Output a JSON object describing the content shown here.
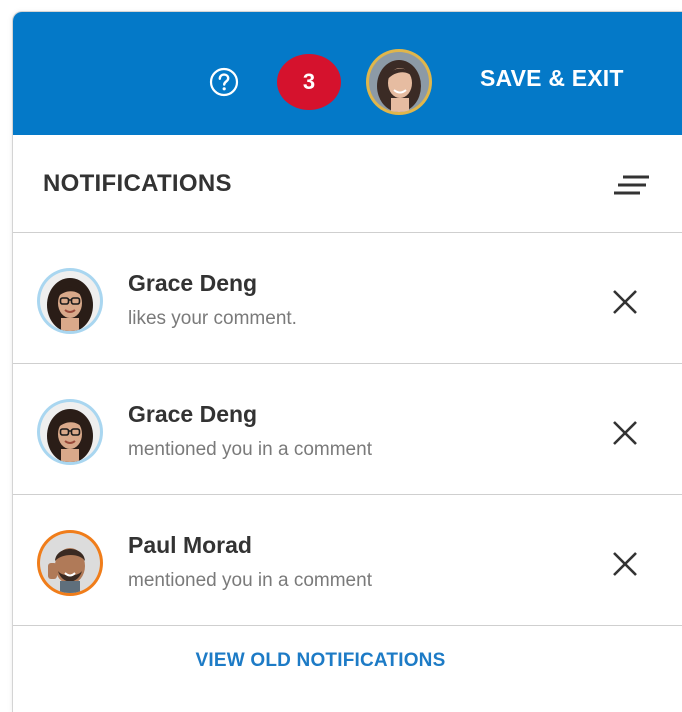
{
  "topbar": {
    "help_icon": "help-circle-icon",
    "notification_count": "3",
    "badge_color": "#d5122d",
    "bar_color": "#0479c8",
    "save_exit_label": "SAVE & EXIT"
  },
  "header": {
    "title": "NOTIFICATIONS",
    "sort_icon": "sort-lines-icon"
  },
  "notifications": [
    {
      "name": "Grace Deng",
      "message": "likes your comment.",
      "avatar_ring": "#a9d6f0"
    },
    {
      "name": "Grace Deng",
      "message": "mentioned you in a comment",
      "avatar_ring": "#a9d6f0"
    },
    {
      "name": "Paul Morad",
      "message": "mentioned you in a comment",
      "avatar_ring": "#f07d1a"
    }
  ],
  "footer": {
    "view_old_label": "VIEW OLD NOTIFICATIONS"
  }
}
